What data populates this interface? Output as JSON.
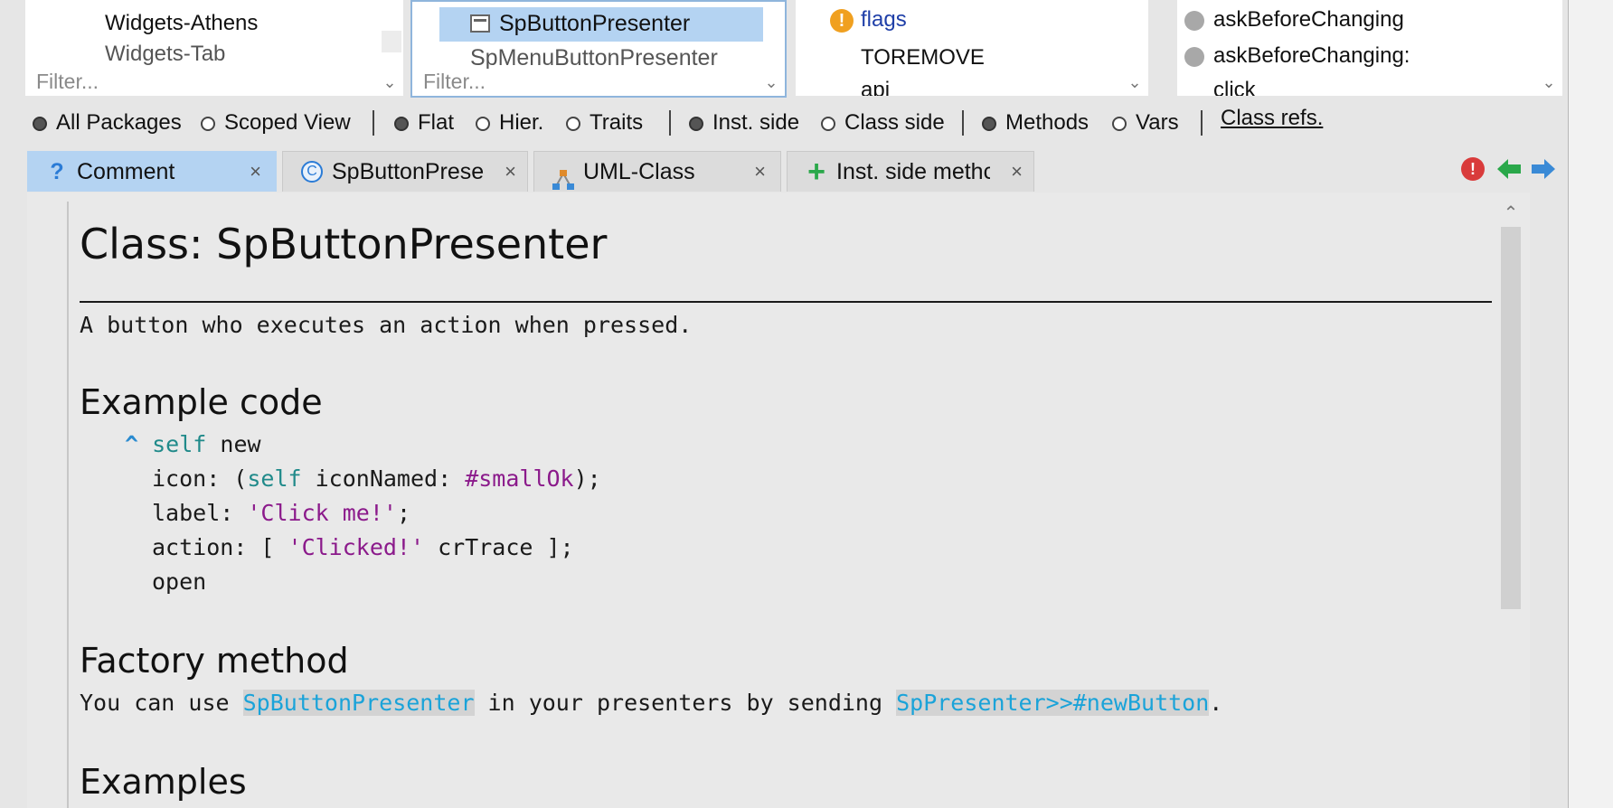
{
  "packages_pane": {
    "item_label": "Widgets-Athens",
    "item_partial": "Widgets-Tab",
    "filter_placeholder": "Filter..."
  },
  "classes_pane": {
    "selected_label": "SpButtonPresenter",
    "partial_label": "SpMenuButtonPresenter",
    "filter_placeholder": "Filter..."
  },
  "protocols_pane": {
    "items": [
      "flags",
      "TOREMOVE",
      "api"
    ]
  },
  "methods_pane": {
    "items": [
      "askBeforeChanging",
      "askBeforeChanging:",
      "click"
    ]
  },
  "toolbar": {
    "all_packages": "All Packages",
    "scoped_view": "Scoped View",
    "flat": "Flat",
    "hier": "Hier.",
    "traits": "Traits",
    "inst_side": "Inst. side",
    "class_side": "Class side",
    "methods": "Methods",
    "vars": "Vars",
    "class_refs": "Class refs."
  },
  "tabs": [
    {
      "label": "Comment",
      "icon": "?"
    },
    {
      "label": "SpButtonPreser",
      "icon": "C"
    },
    {
      "label": "UML-Class",
      "icon": "uml"
    },
    {
      "label": "Inst. side methc",
      "icon": "+"
    }
  ],
  "close_glyph": "×",
  "content": {
    "title": "Class: SpButtonPresenter",
    "description": "A button who executes an action when pressed.",
    "example_heading": "Example code",
    "code": {
      "caret": "^",
      "l1_self": "self",
      "l1_rest": " new",
      "l2_a": "icon: (",
      "l2_self": "self",
      "l2_b": " iconNamed: ",
      "l2_sym": "#smallOk",
      "l2_c": ");",
      "l3_a": "label: ",
      "l3_str": "'Click me!'",
      "l3_b": ";",
      "l4_a": "action: [ ",
      "l4_str": "'Clicked!'",
      "l4_b": " crTrace ];",
      "l5": "open"
    },
    "factory_heading": "Factory method",
    "factory_text_1": "You can use ",
    "factory_link_1": "SpButtonPresenter",
    "factory_text_2": " in your presenters by sending ",
    "factory_link_2": "SpPresenter>>#newButton",
    "factory_text_3": ".",
    "examples_heading": "Examples"
  },
  "colors": {
    "selection": "#b4d3f2",
    "keyword": "#208a8a",
    "symbol": "#8b1a8b",
    "link": "#1aa3d9",
    "protocol_link": "#1f3fa8",
    "error_icon": "#d93b3b",
    "back_arrow": "#2aa84a",
    "forward_arrow": "#3a8ad6"
  }
}
